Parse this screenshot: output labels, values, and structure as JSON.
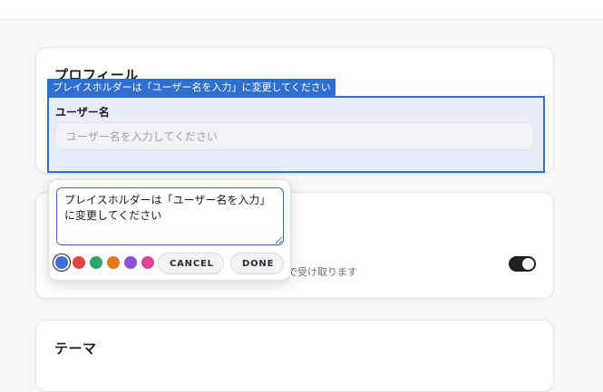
{
  "profile": {
    "title": "プロフィール",
    "annotation_tag": "プレイスホルダーは「ユーザー名を入力」に変更してください",
    "username_label": "ユーザー名",
    "username_placeholder": "ユーザー名を入力してください",
    "username_value": ""
  },
  "notifications": {
    "description_fragment": "で受け取ります",
    "toggle_on": true
  },
  "theme": {
    "title": "テーマ"
  },
  "comment_popover": {
    "text": "プレイスホルダーは「ユーザー名を入力」に変更してください",
    "colors": [
      {
        "name": "blue",
        "hex": "#3c6fd6",
        "selected": true
      },
      {
        "name": "red",
        "hex": "#e04646"
      },
      {
        "name": "green",
        "hex": "#2fa56b"
      },
      {
        "name": "orange",
        "hex": "#e07a1f"
      },
      {
        "name": "purple",
        "hex": "#8e50d8"
      },
      {
        "name": "pink",
        "hex": "#d9459a"
      }
    ],
    "cancel_label": "CANCEL",
    "done_label": "DONE"
  },
  "colors": {
    "accent": "#2f6fd0",
    "toggle_track": "#1f2023"
  }
}
